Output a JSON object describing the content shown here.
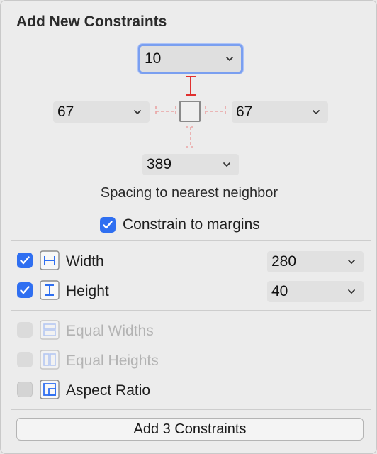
{
  "panel": {
    "title": "Add New Constraints"
  },
  "spacing": {
    "top": "10",
    "left": "67",
    "right": "67",
    "bottom": "389",
    "caption": "Spacing to nearest neighbor"
  },
  "constrain_to_margins": {
    "label": "Constrain to margins",
    "checked": true
  },
  "size": {
    "width": {
      "label": "Width",
      "value": "280",
      "checked": true,
      "icon": "width-constraint-icon"
    },
    "height": {
      "label": "Height",
      "value": "40",
      "checked": true,
      "icon": "height-constraint-icon"
    }
  },
  "equality": {
    "equal_widths": {
      "label": "Equal Widths",
      "enabled": false,
      "icon": "equal-widths-icon"
    },
    "equal_heights": {
      "label": "Equal Heights",
      "enabled": false,
      "icon": "equal-heights-icon"
    },
    "aspect_ratio": {
      "label": "Aspect Ratio",
      "checked": false,
      "icon": "aspect-ratio-icon"
    }
  },
  "add_button": {
    "label": "Add 3 Constraints"
  },
  "colors": {
    "accent": "#2f6ff1",
    "focus_ring": "#7a9ff0",
    "active_strut": "#e0302f",
    "inactive_strut": "#e9a3a3"
  }
}
